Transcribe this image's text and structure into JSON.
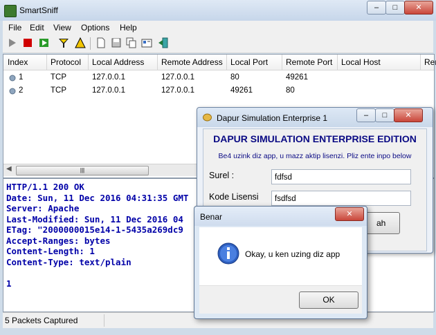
{
  "main": {
    "title": "SmartSniff",
    "menu": [
      "File",
      "Edit",
      "View",
      "Options",
      "Help"
    ],
    "columns": [
      "Index",
      "Protocol",
      "Local Address",
      "Remote Address",
      "Local Port",
      "Remote Port",
      "Local Host",
      "Rem"
    ],
    "rows": [
      {
        "index": "1",
        "protocol": "TCP",
        "local_address": "127.0.0.1",
        "remote_address": "127.0.0.1",
        "local_port": "80",
        "remote_port": "49261"
      },
      {
        "index": "2",
        "protocol": "TCP",
        "local_address": "127.0.0.1",
        "remote_address": "127.0.0.1",
        "local_port": "49261",
        "remote_port": "80"
      }
    ],
    "scroll_grip": "|||",
    "content_lines": [
      "HTTP/1.1 200 OK",
      "Date: Sun, 11 Dec 2016 04:31:35 GMT",
      "Server: Apache",
      "Last-Modified: Sun, 11 Dec 2016 04",
      "ETag: \"2000000015e14-1-5435a269dc9",
      "Accept-Ranges: bytes",
      "Content-Length: 1",
      "Content-Type: text/plain",
      "",
      "1"
    ],
    "status": "5 Packets Captured"
  },
  "dapur": {
    "title": "Dapur Simulation Enterprise 1",
    "heading": "DAPUR SIMULATION ENTERPRISE EDITION",
    "subtitle": "Be4 uzink diz app, u mazz aktip lisenzi. Pliz ente inpo below",
    "email_label": "Surel :",
    "email_value": "fdfsd",
    "license_label": "Kode Lisensi",
    "license_value": "fsdfsd",
    "button_partial": "ah"
  },
  "benar": {
    "title": "Benar",
    "message": "Okay, u ken uzing diz app",
    "ok": "OK"
  },
  "colors": {
    "accent": "#0000a8",
    "titlebar": "#c6d6ea"
  }
}
